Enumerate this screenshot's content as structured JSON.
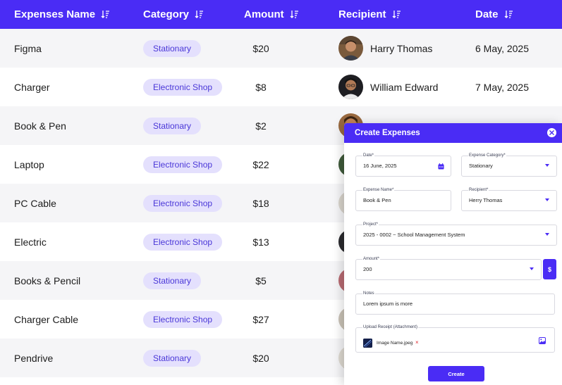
{
  "colors": {
    "accent": "#4a2cf5",
    "pill_bg": "#e4e0fd",
    "pill_text": "#4a37d8",
    "row_alt": "#f5f5f7",
    "danger": "#e0262b"
  },
  "table": {
    "headers": [
      {
        "label": "Expenses Name",
        "icon": "sort-descending-icon"
      },
      {
        "label": "Category",
        "icon": "sort-descending-icon"
      },
      {
        "label": "Amount",
        "icon": "sort-descending-icon"
      },
      {
        "label": "Recipient",
        "icon": "sort-descending-icon"
      },
      {
        "label": "Date",
        "icon": "sort-descending-icon"
      }
    ],
    "rows": [
      {
        "name": "Figma",
        "category": "Stationary",
        "amount": "$20",
        "recipient": "Harry Thomas",
        "date": "6 May, 2025"
      },
      {
        "name": "Charger",
        "category": "Electronic Shop",
        "amount": "$8",
        "recipient": "William Edward",
        "date": "7 May, 2025"
      },
      {
        "name": "Book & Pen",
        "category": "Stationary",
        "amount": "$2"
      },
      {
        "name": "Laptop",
        "category": "Electronic Shop",
        "amount": "$22"
      },
      {
        "name": "PC Cable",
        "category": "Electronic Shop",
        "amount": "$18"
      },
      {
        "name": "Electric",
        "category": "Electronic Shop",
        "amount": "$13"
      },
      {
        "name": "Books & Pencil",
        "category": "Stationary",
        "amount": "$5"
      },
      {
        "name": "Charger Cable",
        "category": "Electronic Shop",
        "amount": "$27"
      },
      {
        "name": "Pendrive",
        "category": "Stationary",
        "amount": "$20"
      }
    ]
  },
  "modal": {
    "title": "Create Expenses",
    "date": {
      "label": "Date*",
      "value": "16 June, 2025",
      "icon": "calendar-icon"
    },
    "category": {
      "label": "Expense Category*",
      "value": "Stationary"
    },
    "expense_name": {
      "label": "Expense Name*",
      "value": "Book & Pen"
    },
    "recipient": {
      "label": "Recipient*",
      "value": "Herry Thomas"
    },
    "project": {
      "label": "Project*",
      "value": "2025 - 0002 ~ School Management System"
    },
    "amount": {
      "label": "Amount*",
      "value": "200",
      "currency": "$"
    },
    "notes": {
      "label": "Notes",
      "value": "Lorem ipsum is more"
    },
    "upload": {
      "label": "Upload Receipt (Attachment)",
      "file_name": "Image Name.jpeg",
      "remove": "×",
      "icon": "image-icon"
    },
    "submit_label": "Create"
  }
}
